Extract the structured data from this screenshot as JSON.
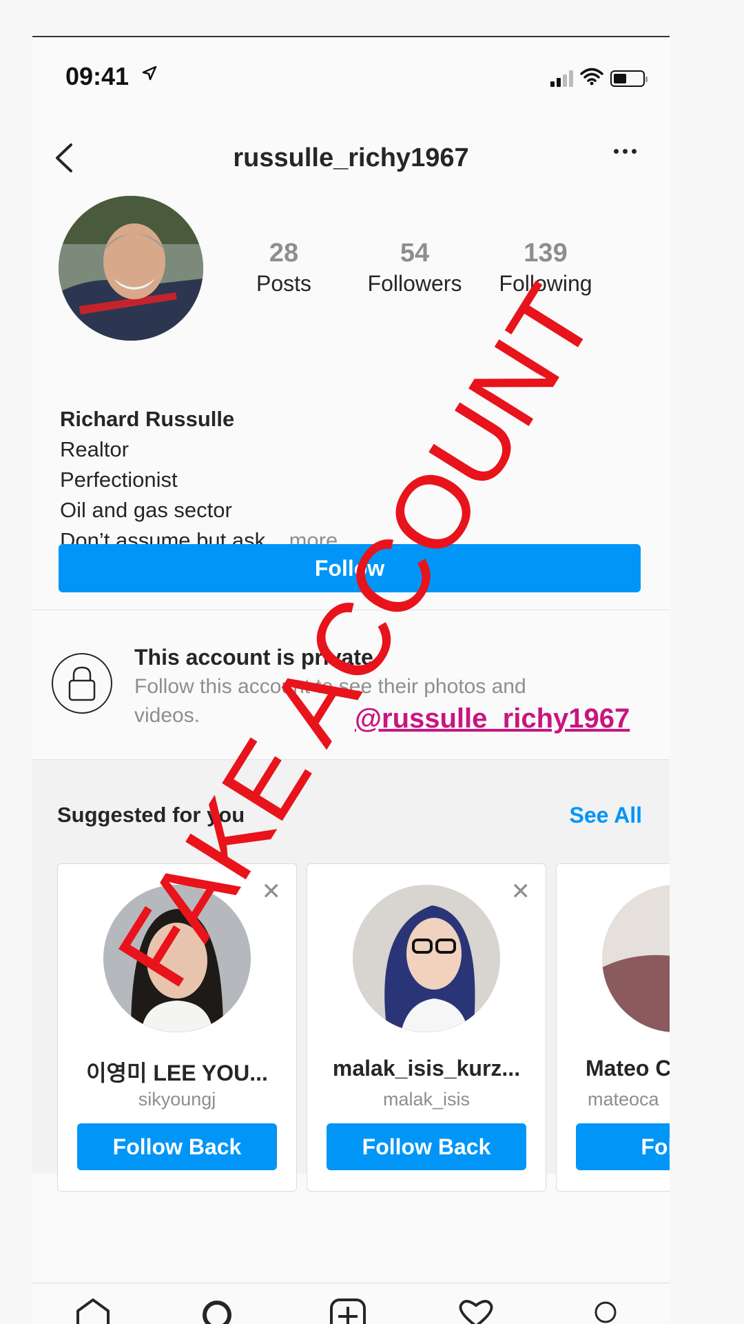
{
  "status_bar": {
    "time": "09:41",
    "battery_level": 0.45
  },
  "nav": {
    "title": "russulle_richy1967"
  },
  "profile": {
    "stats": [
      {
        "num": "28",
        "label": "Posts"
      },
      {
        "num": "54",
        "label": "Followers"
      },
      {
        "num": "139",
        "label": "Following"
      }
    ],
    "name": "Richard Russulle",
    "bio_lines": [
      "Realtor",
      "Perfectionist",
      "Oil and gas sector"
    ],
    "bio_last": "Don’t assume but ask...",
    "bio_more": "more",
    "follow_label": "Follow"
  },
  "private": {
    "title": "This account is private",
    "desc": "Follow this account to see their photos and videos."
  },
  "overlay": {
    "stamp": "FAKE ACCOUNT",
    "handle": "@russulle_richy1967",
    "stamp_color": "#e8131b",
    "handle_color": "#c8157f"
  },
  "suggested": {
    "title": "Suggested for you",
    "see_all": "See All",
    "cards": [
      {
        "name": "이영미  LEE YOU...",
        "handle": "sikyoungj",
        "button": "Follow Back"
      },
      {
        "name": "malak_isis_kurz...",
        "handle": "malak_isis",
        "button": "Follow Back"
      },
      {
        "name": "Mateo C",
        "handle": "mateoca",
        "button": "Follow"
      }
    ]
  },
  "tabbar": {
    "icons": [
      "home-icon",
      "search-icon",
      "add-post-icon",
      "heart-icon",
      "profile-icon"
    ]
  },
  "colors": {
    "accent": "#0095f6",
    "text": "#262626",
    "muted": "#8e8e8e"
  }
}
